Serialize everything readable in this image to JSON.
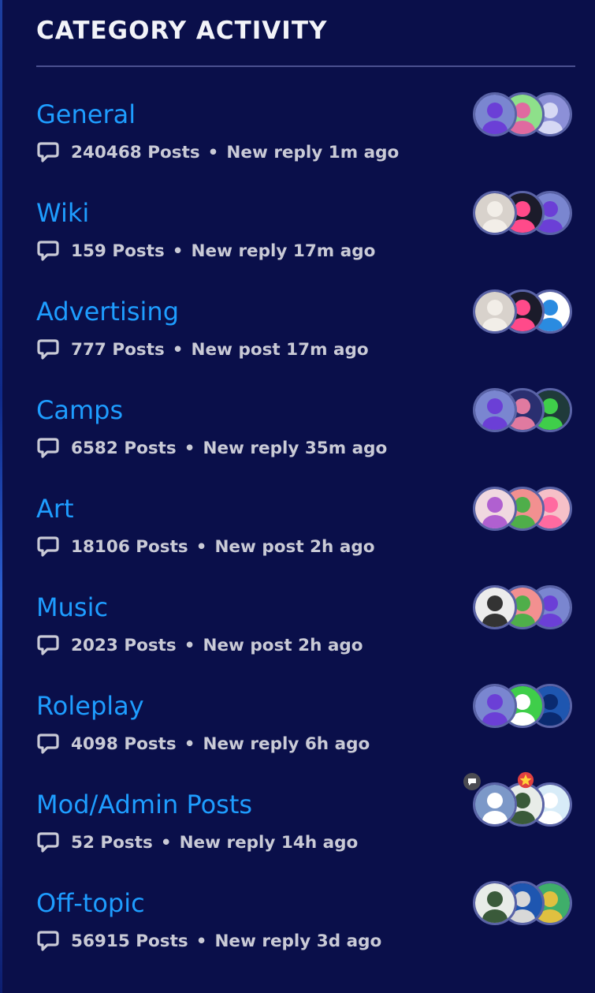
{
  "heading": "CATEGORY ACTIVITY",
  "colors": {
    "background": "#0a0f4a",
    "link": "#1e9dff",
    "meta_text": "#c9cad6",
    "divider": "#4a5090"
  },
  "categories": [
    {
      "name": "General",
      "posts": "240468 Posts",
      "activity": "New reply 1m ago",
      "avatars": [
        {
          "bg": "#7a86d0",
          "fg": "#6b3fd6"
        },
        {
          "bg": "#8ee08a",
          "fg": "#e06aa0"
        },
        {
          "bg": "#8c90d8",
          "fg": "#d6d8f4"
        }
      ]
    },
    {
      "name": "Wiki",
      "posts": "159 Posts",
      "activity": "New reply 17m ago",
      "avatars": [
        {
          "bg": "#d8d2cc",
          "fg": "#f2eee8"
        },
        {
          "bg": "#1b1b2a",
          "fg": "#ff4a8a"
        },
        {
          "bg": "#7a86d0",
          "fg": "#6b3fd6"
        }
      ]
    },
    {
      "name": "Advertising",
      "posts": "777 Posts",
      "activity": "New post 17m ago",
      "avatars": [
        {
          "bg": "#d8d2cc",
          "fg": "#f2eee8"
        },
        {
          "bg": "#1b1b2a",
          "fg": "#ff4a8a"
        },
        {
          "bg": "#ffffff",
          "fg": "#2a8be0"
        }
      ]
    },
    {
      "name": "Camps",
      "posts": "6582 Posts",
      "activity": "New reply 35m ago",
      "avatars": [
        {
          "bg": "#7a86d0",
          "fg": "#6b3fd6"
        },
        {
          "bg": "#2a2f70",
          "fg": "#e07aa0"
        },
        {
          "bg": "#1f3a3a",
          "fg": "#3fce4a"
        }
      ]
    },
    {
      "name": "Art",
      "posts": "18106 Posts",
      "activity": "New post 2h ago",
      "avatars": [
        {
          "bg": "#f0d8e0",
          "fg": "#b060d0"
        },
        {
          "bg": "#f29090",
          "fg": "#4fae4a"
        },
        {
          "bg": "#f6c0c8",
          "fg": "#ff6aa0"
        }
      ]
    },
    {
      "name": "Music",
      "posts": "2023 Posts",
      "activity": "New post 2h ago",
      "avatars": [
        {
          "bg": "#ececec",
          "fg": "#333333"
        },
        {
          "bg": "#f29090",
          "fg": "#4fae4a"
        },
        {
          "bg": "#7a86d0",
          "fg": "#6b3fd6"
        }
      ]
    },
    {
      "name": "Roleplay",
      "posts": "4098 Posts",
      "activity": "New reply 6h ago",
      "avatars": [
        {
          "bg": "#7a86d0",
          "fg": "#6b3fd6"
        },
        {
          "bg": "#3fce4a",
          "fg": "#ffffff"
        },
        {
          "bg": "#1e56b0",
          "fg": "#0a2a70"
        }
      ]
    },
    {
      "name": "Mod/Admin Posts",
      "posts": "52 Posts",
      "activity": "New reply 14h ago",
      "avatars": [
        {
          "bg": "#7c98c8",
          "fg": "#ffffff"
        },
        {
          "bg": "#e8ece8",
          "fg": "#3a5a3a"
        },
        {
          "bg": "#d8ecf8",
          "fg": "#ffffff"
        }
      ]
    },
    {
      "name": "Off-topic",
      "posts": "56915 Posts",
      "activity": "New reply 3d ago",
      "avatars": [
        {
          "bg": "#e8ece8",
          "fg": "#3a5a3a"
        },
        {
          "bg": "#1e56b0",
          "fg": "#d8d8d8"
        },
        {
          "bg": "#3fae6a",
          "fg": "#e0c040"
        }
      ]
    }
  ]
}
